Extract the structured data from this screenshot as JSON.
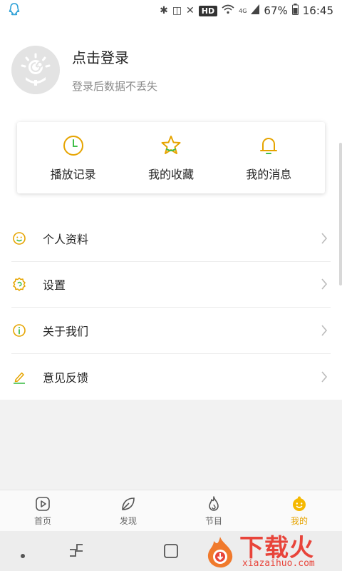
{
  "status_bar": {
    "battery": "67%",
    "time": "16:45",
    "hd_badge": "HD",
    "signal_badge": "4G"
  },
  "profile": {
    "title": "点击登录",
    "subtitle": "登录后数据不丢失"
  },
  "shortcuts": [
    {
      "label": "播放记录",
      "icon": "clock-icon"
    },
    {
      "label": "我的收藏",
      "icon": "star-icon"
    },
    {
      "label": "我的消息",
      "icon": "bell-icon"
    }
  ],
  "menu": [
    {
      "label": "个人资料",
      "icon": "smiley-icon"
    },
    {
      "label": "设置",
      "icon": "settings-icon"
    },
    {
      "label": "关于我们",
      "icon": "info-icon"
    },
    {
      "label": "意见反馈",
      "icon": "pencil-icon"
    }
  ],
  "bottom_nav": [
    {
      "label": "首页",
      "icon": "play-icon",
      "active": false
    },
    {
      "label": "发现",
      "icon": "leaf-icon",
      "active": false
    },
    {
      "label": "节目",
      "icon": "flame-icon",
      "active": false
    },
    {
      "label": "我的",
      "icon": "face-icon",
      "active": true
    }
  ],
  "colors": {
    "accent": "#e6a400",
    "green": "#3fbe4a",
    "watermark": "#e8443a"
  },
  "watermark": {
    "text": "下载火",
    "sub": "xiazaihuo.com"
  }
}
